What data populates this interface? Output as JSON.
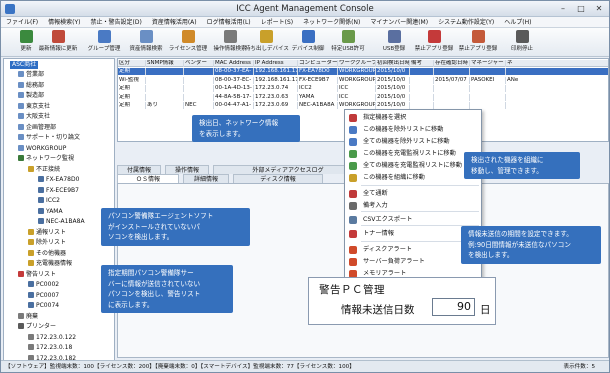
{
  "window": {
    "title": "ICC Agent Management Console"
  },
  "menu": [
    "ファイル(F)",
    "情報検索(Y)",
    "禁止・警告設定(D)",
    "資産情報活用(A)",
    "ログ情報活用(L)",
    "レポート(S)",
    "ネットワーク関係(N)",
    "マイナンバー関連(M)",
    "システム動作設定(Y)",
    "ヘルプ(H)"
  ],
  "toolbar": [
    {
      "label": "更新",
      "icon": "refresh-icon",
      "color": "#3b8a3e"
    },
    {
      "label": "最新情報に更新",
      "icon": "latest-update-icon",
      "color": "#c04a3a"
    },
    {
      "label": "グループ管理",
      "icon": "group-icon",
      "color": "#4a7ac4"
    },
    {
      "label": "資産情報検索",
      "icon": "asset-search-icon",
      "color": "#6a8fc4"
    },
    {
      "label": "ライセンス管理",
      "icon": "license-icon",
      "color": "#d08a2a"
    },
    {
      "label": "操作情報検索",
      "icon": "operation-search-icon",
      "color": "#7a7a7a"
    },
    {
      "label": "持ち出しデバイス",
      "icon": "device-icon",
      "color": "#c9a02a"
    },
    {
      "label": "デバイス制御",
      "icon": "device-control-icon",
      "color": "#3a6fc2"
    },
    {
      "label": "特定USB許可",
      "icon": "usb-allow-icon",
      "color": "#6a9a4a"
    },
    {
      "label": "USB登録",
      "icon": "usb-register-icon",
      "color": "#5a6fa0"
    },
    {
      "label": "禁止アプリ登録",
      "icon": "block-app-register-icon",
      "color": "#c43a3a"
    },
    {
      "label": "禁止アプリ登録",
      "icon": "block-app-list-icon",
      "color": "#c45a3a"
    },
    {
      "label": "印刷停止",
      "icon": "print-stop-icon",
      "color": "#5a5a5a"
    }
  ],
  "tree": {
    "root": "ASC商社",
    "items": [
      "営業部",
      "総務部",
      "製造部",
      "東京支社",
      "大阪支社",
      "企画管理部",
      "サポート・切り論文",
      "WORKGROUP",
      "ネットワーク監視",
      "不正接続",
      "FX-EA78D0",
      "FX-ECE9B7",
      "ICC2",
      "YAMA",
      "NEC-A1BA8A",
      "通報リスト",
      "除外リスト",
      "その他機器",
      "充電機器情報",
      "警告リスト",
      "PC0002",
      "PC0007",
      "PC0074",
      "廃棄",
      "プリンター",
      "172.23.0.122",
      "172.23.0.18",
      "172.23.0.182"
    ]
  },
  "grid": {
    "columns": [
      "区分",
      "SNMP情報",
      "ベンダー",
      "MAC Address",
      "IP Address",
      "コンピューター名",
      "ワークグループ",
      "初回検出日時",
      "備考",
      "存在確認日時",
      "マネージャー",
      "ネ"
    ],
    "rows": [
      [
        "定期",
        "",
        "",
        "08-00-37-EA-",
        "192.168.161.176",
        "FX-EA78D0",
        "WORKGROUP",
        "2015/10/0",
        "",
        "",
        "",
        ""
      ],
      [
        "Wi-監視",
        "",
        "",
        "08-00-37-EC-",
        "192.168.161.17",
        "FX-ECE9B7",
        "WORKGROUP",
        "2015/10/0",
        "",
        "2015/07/07",
        "PASOKEI",
        "ANe"
      ],
      [
        "定期",
        "",
        "",
        "00-1A-4D-13-",
        "172.23.0.74",
        "ICC2",
        "ICC",
        "2015/10/0",
        "",
        "",
        "",
        ""
      ],
      [
        "定期",
        "",
        "",
        "44-8A-5B-17-",
        "172.23.0.63",
        "YAMA",
        "ICC",
        "2015/10/0",
        "",
        "",
        "",
        ""
      ],
      [
        "定期",
        "あり",
        "NEC",
        "00-04-47-A1-",
        "172.23.0.69",
        "NEC-A1BA8A",
        "WORKGROUP",
        "2015/10/0",
        "",
        "",
        "",
        ""
      ]
    ]
  },
  "tabs_top": [
    "付属情報",
    "操作情報",
    "外部メディアアクセスログ",
    "メール情報",
    "パッチ情報"
  ],
  "tabs_sub": [
    "ＯＳ情報",
    "詳細情報",
    "ディスク情報"
  ],
  "context_menu": [
    {
      "label": "指定機器を選択",
      "icon": "select-icon",
      "color": "#c03a3a"
    },
    {
      "label": "この機器を除外リストに移動",
      "icon": "exclude-icon",
      "color": "#4a7ac4"
    },
    {
      "label": "全ての機器を除外リストに移動",
      "icon": "exclude-all-icon",
      "color": "#4a7ac4"
    },
    {
      "label": "この機器を充電監視リストに移動",
      "icon": "charge-icon",
      "color": "#4a9a4a"
    },
    {
      "label": "全ての機器を充電監視リストに移動",
      "icon": "charge-all-icon",
      "color": "#4a9a4a"
    },
    {
      "label": "この機器を組織に移動",
      "icon": "move-org-icon",
      "color": "#c9a02a"
    },
    {
      "label": "全て通断",
      "icon": "block-all-icon",
      "color": "#c03a3a"
    },
    {
      "label": "備考入力",
      "icon": "note-icon",
      "color": "#6a6a6a"
    },
    {
      "label": "CSVエクスポート",
      "icon": "csv-icon",
      "color": "#5a7aa0"
    },
    {
      "label": "トナー情報",
      "icon": "toner-icon",
      "color": "#c43a3a"
    },
    {
      "label": "ディスクアラート",
      "icon": "disk-alert-icon",
      "color": "#d04a2a"
    },
    {
      "label": "サーバー負荷アラート",
      "icon": "server-alert-icon",
      "color": "#d04a2a"
    },
    {
      "label": "メモリアラート",
      "icon": "memory-alert-icon",
      "color": "#d04a2a"
    },
    {
      "label": "プリンターアラート",
      "icon": "printer-alert-icon",
      "color": "#d04a2a"
    },
    {
      "label": "トナーアラート",
      "icon": "toner-alert-icon",
      "color": "#d04a2a"
    }
  ],
  "callouts": {
    "c1": "検出日、ネットワーク情報\nを表示します。",
    "c2": "パソコン警備隊エージェントソフト\nがインストールされていないパ\nソコンを検出します。",
    "c3": "指定期間パソコン警備隊サー\nバーに情報が送信されていない\nパソコンを検出し、警告リスト\nに表示します。",
    "c4": "検出された機器を組織に\n移動し、管理できます。",
    "c5": "情報未送信の期間を設定できます。\n例:90日間情報が未送信なパソコン\nを検出します。"
  },
  "alert_pane": {
    "title": "警告ＰＣ管理",
    "label": "情報未送信日数",
    "value": "90",
    "unit": "日"
  },
  "status": {
    "left": "【ソフトウェア】監視端末数：100【ライセンス数：200】【廃棄端末数：0】【スマートデバイス】監視端末数：77【ライセンス数：100】",
    "right": "表示件数：5"
  },
  "colors": {
    "accent": "#3570bd",
    "selection": "#2f6ec4"
  }
}
